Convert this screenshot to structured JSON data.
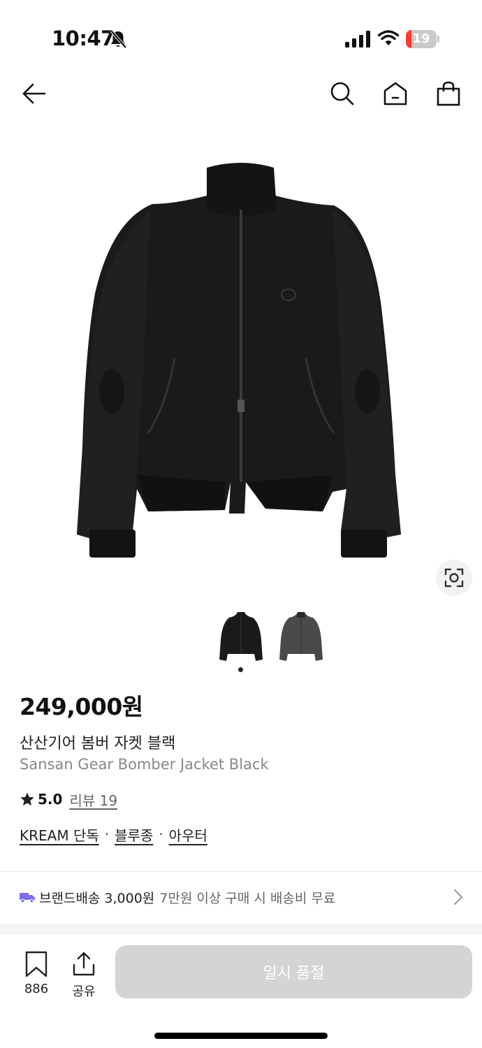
{
  "status_bar": {
    "time": "10:47",
    "battery_level": "19",
    "battery_fraction": 0.19,
    "icons": [
      "bell-off-icon",
      "signal-icon",
      "wifi-icon",
      "battery-icon"
    ]
  },
  "nav": {
    "icons": [
      "back-arrow-icon",
      "search-icon",
      "home-icon",
      "shopping-bag-icon"
    ]
  },
  "product": {
    "image": "black-bomber-jacket",
    "thumbnails": [
      "black-jacket-thumb",
      "gray-jacket-thumb"
    ],
    "price": "249,000원",
    "name_ko": "산산기어 봄버 자켓 블랙",
    "name_en": "Sansan Gear Bomber Jacket Black",
    "rating": "5.0",
    "review_label": "리뷰 19",
    "tags": [
      "KREAM 단독",
      "블루종",
      "아우터"
    ],
    "tag_separator": "·"
  },
  "shipping": {
    "label": "브랜드배송",
    "price": "3,000원",
    "note": "7만원 이상 구매 시 배송비 무료"
  },
  "bottom_bar": {
    "bookmark_count": "886",
    "share_label": "공유",
    "buy_label": "일시 품절"
  },
  "colors": {
    "accent_truck": "#7b6cf0",
    "battery_low": "#ff3b30",
    "disabled_button": "#d4d4d4"
  }
}
